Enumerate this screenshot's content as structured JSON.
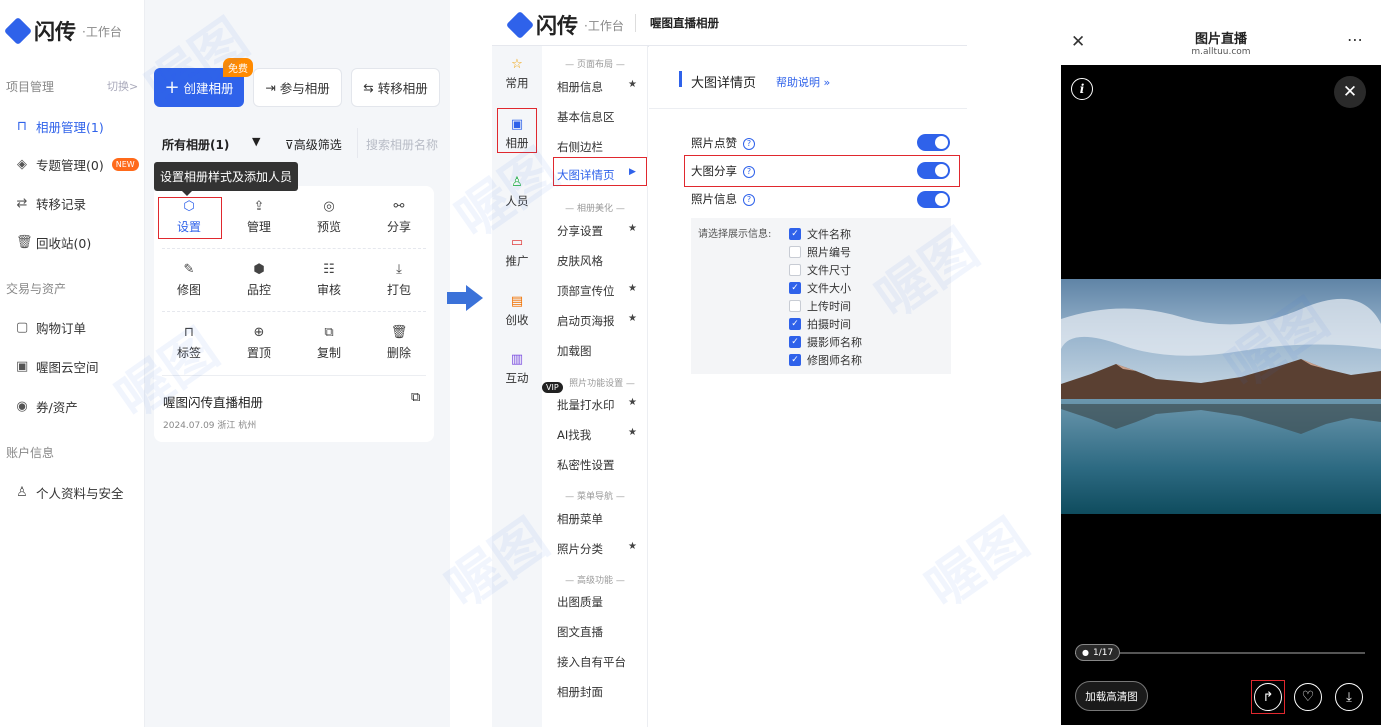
{
  "brand": {
    "name": "闪传",
    "sub": "工作台"
  },
  "panel1": {
    "sidebar": {
      "section_project": "项目管理",
      "switch": "切换>",
      "items_project": [
        {
          "label": "相册管理(1)",
          "icon": "album-icon",
          "active": true
        },
        {
          "label": "专题管理(0)",
          "icon": "layers-icon",
          "badge": "NEW"
        },
        {
          "label": "转移记录",
          "icon": "transfer-icon"
        },
        {
          "label": "回收站(0)",
          "icon": "trash-icon"
        }
      ],
      "section_trade": "交易与资产",
      "items_trade": [
        {
          "label": "购物订单",
          "icon": "bag-icon"
        },
        {
          "label": "喔图云空间",
          "icon": "cloud-icon"
        },
        {
          "label": "券/资产",
          "icon": "coupon-icon"
        }
      ],
      "section_account": "账户信息",
      "items_account": [
        {
          "label": "个人资料与安全",
          "icon": "user-icon"
        }
      ]
    },
    "toolbar": {
      "create": "创建相册",
      "free_badge": "免费",
      "join": "参与相册",
      "transfer": "转移相册"
    },
    "filter": {
      "all": "所有相册(1)",
      "advanced": "高级筛选",
      "search_placeholder": "搜索相册名称"
    },
    "tooltip": "设置相册样式及添加人员",
    "actions": [
      {
        "label": "设置",
        "icon": "settings-icon"
      },
      {
        "label": "管理",
        "icon": "manage-icon"
      },
      {
        "label": "预览",
        "icon": "preview-icon"
      },
      {
        "label": "分享",
        "icon": "share-icon"
      },
      {
        "label": "修图",
        "icon": "retouch-icon"
      },
      {
        "label": "品控",
        "icon": "quality-icon"
      },
      {
        "label": "审核",
        "icon": "review-icon"
      },
      {
        "label": "打包",
        "icon": "download-icon"
      },
      {
        "label": "标签",
        "icon": "tag-icon"
      },
      {
        "label": "置顶",
        "icon": "pin-top-icon"
      },
      {
        "label": "复制",
        "icon": "copy-icon"
      },
      {
        "label": "删除",
        "icon": "delete-icon"
      }
    ],
    "album": {
      "title": "喔图闪传直播相册",
      "meta": "2024.07.09 浙江 杭州"
    }
  },
  "panel2": {
    "header_title": "喔图直播相册",
    "rail": [
      {
        "label": "常用",
        "icon": "star-icon"
      },
      {
        "label": "相册",
        "icon": "album-icon"
      },
      {
        "label": "人员",
        "icon": "people-icon"
      },
      {
        "label": "推广",
        "icon": "promote-icon"
      },
      {
        "label": "创收",
        "icon": "revenue-icon"
      },
      {
        "label": "互动",
        "icon": "chat-icon"
      }
    ],
    "menu_headers": [
      "— 页面布局 —",
      "— 相册美化 —",
      "照片功能设置 —",
      "— 菜单导航 —",
      "— 高级功能 —"
    ],
    "menu_items": [
      "相册信息",
      "基本信息区",
      "右侧边栏",
      "大图详情页",
      "分享设置",
      "皮肤风格",
      "顶部宣传位",
      "启动页海报",
      "加载图",
      "批量打水印",
      "AI找我",
      "私密性设置",
      "相册菜单",
      "照片分类",
      "出图质量",
      "图文直播",
      "接入自有平台",
      "相册封面"
    ],
    "vip": "VIP",
    "detail": {
      "title": "大图详情页",
      "help": "帮助说明 »",
      "settings": [
        {
          "label": "照片点赞",
          "on": true
        },
        {
          "label": "大图分享",
          "on": true
        },
        {
          "label": "照片信息",
          "on": true
        }
      ],
      "info_prompt": "请选择展示信息:",
      "info_options": [
        {
          "label": "文件名称",
          "checked": true
        },
        {
          "label": "照片编号",
          "checked": false
        },
        {
          "label": "文件尺寸",
          "checked": false
        },
        {
          "label": "文件大小",
          "checked": true
        },
        {
          "label": "上传时间",
          "checked": false
        },
        {
          "label": "拍摄时间",
          "checked": true
        },
        {
          "label": "摄影师名称",
          "checked": true
        },
        {
          "label": "修图师名称",
          "checked": true
        }
      ]
    }
  },
  "panel3": {
    "title": "图片直播",
    "url": "m.alltuu.com",
    "counter": "1/17",
    "load_hd": "加载高清图",
    "progress_fraction": 0.06
  },
  "watermark": "喔图",
  "colors": {
    "accent": "#2f62ea",
    "highlight": "#e0282e",
    "badge": "#ff8a00"
  }
}
